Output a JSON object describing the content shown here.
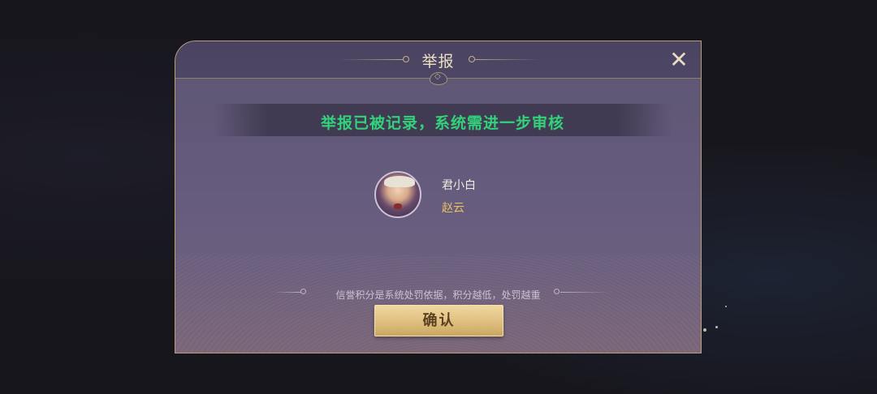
{
  "dialog": {
    "title": "举报",
    "close_icon": "close-icon",
    "status_message": "举报已被记录，系统需进一步审核",
    "reported_player": {
      "name": "君小白",
      "hero": "赵云",
      "avatar_icon": "hero-portrait"
    },
    "note": "信誉积分是系统处罚依据，积分越低，处罚越重",
    "confirm_label": "确认"
  },
  "colors": {
    "status_green": "#33d27a",
    "hero_gold": "#e5c064",
    "button_gold": "#dcbc7c",
    "border_gold": "#b89f74"
  }
}
